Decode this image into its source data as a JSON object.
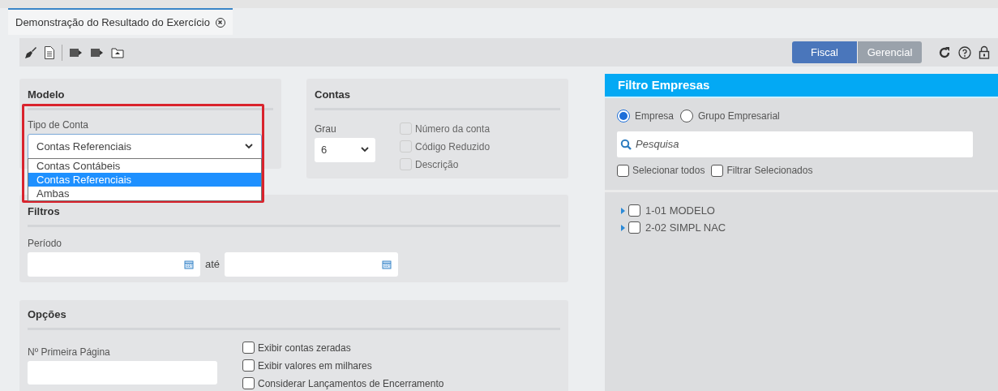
{
  "tabs": [
    {
      "label": "Demonstração do Resultado do Exercício",
      "selected": true
    }
  ],
  "view_toggle": [
    {
      "label": "Fiscal",
      "selected": true
    },
    {
      "label": "Gerencial",
      "selected": false
    }
  ],
  "modelo": {
    "title": "Modelo",
    "field_label": "Tipo de Conta",
    "value": "Contas Referenciais",
    "options": [
      {
        "label": "Contas Contábeis",
        "selected": false
      },
      {
        "label": "Contas Referenciais",
        "selected": true
      },
      {
        "label": "Ambas",
        "selected": false
      }
    ]
  },
  "contas": {
    "title": "Contas",
    "grau_label": "Grau",
    "grau_value": "6",
    "checkboxes": [
      {
        "label": "Número da conta",
        "checked": false,
        "disabled": true
      },
      {
        "label": "Código Reduzido",
        "checked": false,
        "disabled": true
      },
      {
        "label": "Descrição",
        "checked": false,
        "disabled": true
      }
    ]
  },
  "filtros": {
    "title": "Filtros",
    "period_label": "Período",
    "between": "até"
  },
  "opcoes": {
    "title": "Opções",
    "page_label": "Nº Primeira Página",
    "checkboxes": [
      {
        "label": "Exibir contas zeradas",
        "checked": false
      },
      {
        "label": "Exibir valores em milhares",
        "checked": false
      },
      {
        "label": "Considerar Lançamentos de Encerramento",
        "checked": false
      }
    ]
  },
  "filtro_empresas": {
    "title": "Filtro Empresas",
    "radios": [
      {
        "label": "Empresa",
        "selected": true
      },
      {
        "label": "Grupo Empresarial",
        "selected": false
      }
    ],
    "search_placeholder": "Pesquisa",
    "checkboxes": [
      {
        "label": "Selecionar todos",
        "checked": false
      },
      {
        "label": "Filtrar Selecionados",
        "checked": false
      }
    ],
    "tree": [
      {
        "label": "1-01 MODELO",
        "checked": false,
        "expanded": false
      },
      {
        "label": "2-02 SIMPL NAC",
        "checked": false,
        "expanded": false
      }
    ]
  }
}
